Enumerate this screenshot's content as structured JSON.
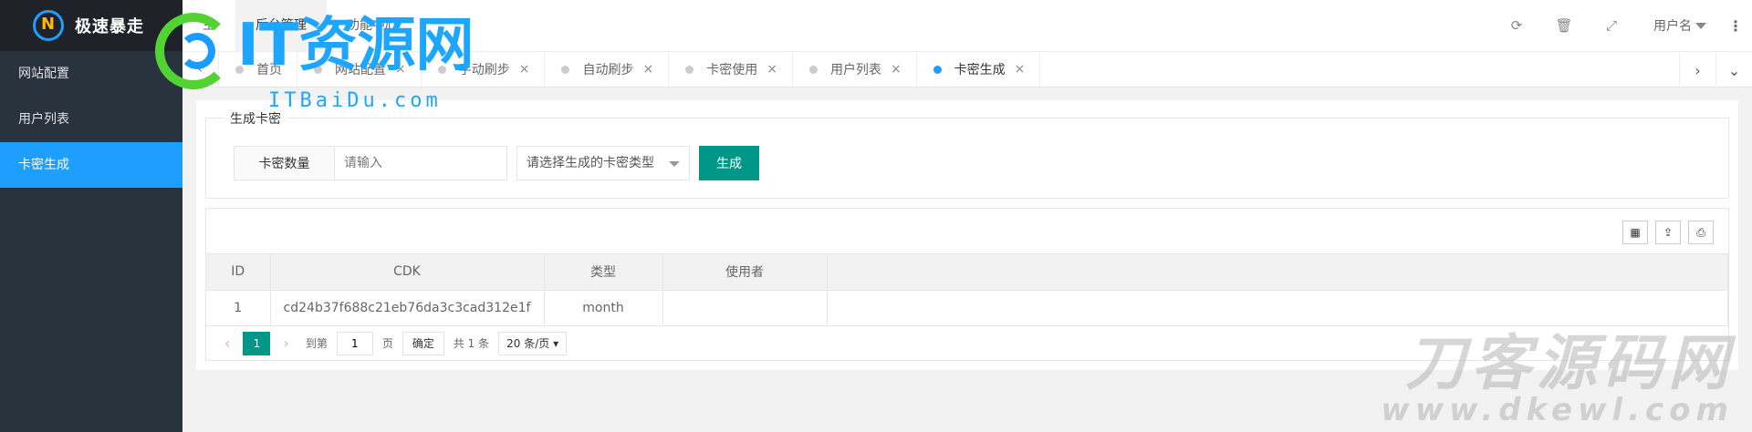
{
  "app": {
    "name": "极速暴走"
  },
  "sidebar": {
    "items": [
      {
        "label": "网站配置",
        "active": false
      },
      {
        "label": "用户列表",
        "active": false
      },
      {
        "label": "卡密生成",
        "active": true
      }
    ]
  },
  "header": {
    "top_menu": [
      {
        "label": "主",
        "active": false
      },
      {
        "label": "后台管理",
        "active": true
      },
      {
        "label": "功能中心",
        "active": false
      }
    ],
    "icons": [
      "refresh-icon",
      "trash-icon",
      "fullscreen-icon"
    ],
    "user_label": "用户名"
  },
  "tabs": [
    {
      "label": "首页",
      "active": false
    },
    {
      "label": "网站配置",
      "active": false
    },
    {
      "label": "手动刷步",
      "active": false
    },
    {
      "label": "自动刷步",
      "active": false
    },
    {
      "label": "卡密使用",
      "active": false
    },
    {
      "label": "用户列表",
      "active": false
    },
    {
      "label": "卡密生成",
      "active": true
    }
  ],
  "form": {
    "legend": "生成卡密",
    "quantity_label": "卡密数量",
    "quantity_placeholder": "请输入",
    "type_placeholder": "请选择生成的卡密类型",
    "submit_label": "生成"
  },
  "table": {
    "toolbar_icons": [
      "columns-icon",
      "export-icon",
      "print-icon"
    ],
    "columns": [
      "ID",
      "CDK",
      "类型",
      "使用者"
    ],
    "rows": [
      {
        "id": "1",
        "cdk": "cd24b37f688c21eb76da3c3cad312e1f",
        "type": "month",
        "user": ""
      }
    ]
  },
  "pager": {
    "current": "1",
    "goto_label": "到第",
    "goto_value": "1",
    "page_unit": "页",
    "confirm_label": "确定",
    "total_label": "共 1 条",
    "limit_label": "20 条/页"
  },
  "watermarks": {
    "top_title": "IT资源网",
    "top_sub": "ITBaiDu.com",
    "bottom_title": "刀客源码网",
    "bottom_sub": "www.dkewl.com"
  },
  "colors": {
    "sidebar_bg": "#28333e",
    "active_blue": "#1e9fff",
    "primary_green": "#009688"
  }
}
